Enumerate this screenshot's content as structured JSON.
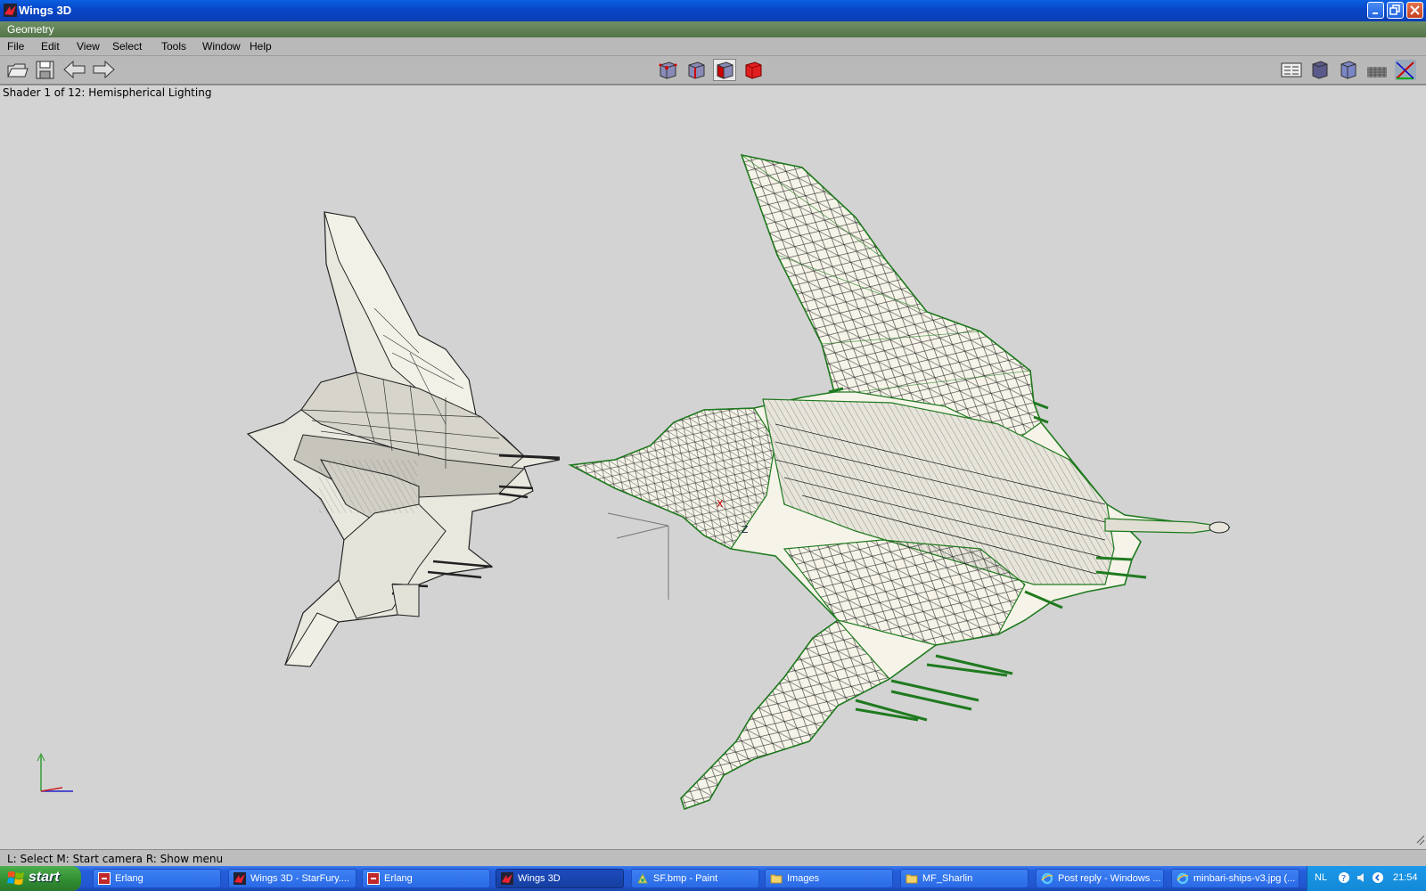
{
  "window": {
    "title": "Wings 3D",
    "app_icon": "wings-icon",
    "buttons": [
      "minimize",
      "maximize",
      "close"
    ]
  },
  "geometry_bar": {
    "label": "Geometry"
  },
  "menu": [
    "File",
    "Edit",
    "View",
    "Select",
    "Tools",
    "Window",
    "Help"
  ],
  "toolbar": {
    "left_icons": [
      "open-icon",
      "save-icon",
      "undo-icon",
      "redo-icon"
    ],
    "selection_modes": [
      "vertex-mode",
      "edge-mode",
      "face-mode",
      "body-mode"
    ],
    "active_mode": "face-mode",
    "right_icons": [
      "outliner-icon",
      "smooth-shade-icon",
      "wireframe-icon",
      "ground-plane-icon",
      "axes-icon"
    ]
  },
  "viewport": {
    "shader_info": "Shader 1 of 12: Hemispherical Lighting",
    "axis_labels": [
      "X",
      "Z"
    ],
    "colors": {
      "background": "#d3d3d3",
      "model_fill": "#f4f2e6",
      "selection_edge": "#2a8a2a"
    }
  },
  "statusbar": {
    "hint": "L: Select   M: Start camera   R: Show menu"
  },
  "taskbar": {
    "start_label": "start",
    "tasks": [
      {
        "label": "Erlang",
        "icon": "erlang-icon",
        "active": false
      },
      {
        "label": "Wings 3D - StarFury....",
        "icon": "wings-icon",
        "active": false
      },
      {
        "label": "Erlang",
        "icon": "erlang-icon",
        "active": false
      },
      {
        "label": "Wings 3D",
        "icon": "wings-icon",
        "active": true
      },
      {
        "label": "SF.bmp - Paint",
        "icon": "paint-icon",
        "active": false
      },
      {
        "label": "Images",
        "icon": "folder-icon",
        "active": false
      },
      {
        "label": "MF_Sharlin",
        "icon": "folder-icon",
        "active": false
      },
      {
        "label": "Post reply - Windows ...",
        "icon": "ie-icon",
        "active": false
      },
      {
        "label": "minbari-ships-v3.jpg (...",
        "icon": "ie-icon",
        "active": false
      }
    ],
    "tray": {
      "language": "NL",
      "clock": "21:54"
    }
  }
}
